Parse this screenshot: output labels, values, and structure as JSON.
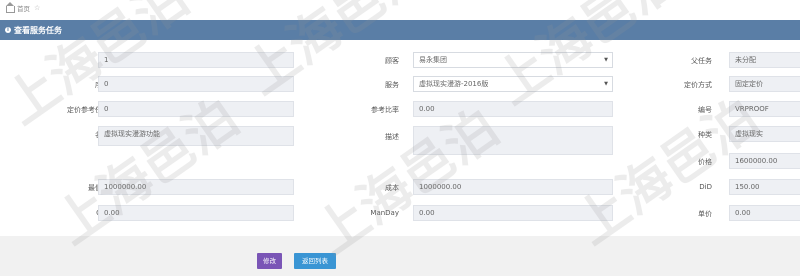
{
  "breadcrumb": {
    "home": "首页"
  },
  "panel": {
    "title": "查看服务任务"
  },
  "fields": {
    "id": {
      "label": "ID",
      "value": "1"
    },
    "client": {
      "label": "顾客",
      "value": "易永集团"
    },
    "parent_task": {
      "label": "父任务",
      "value": "未分配"
    },
    "seq": {
      "label": "序号",
      "value": "0"
    },
    "service": {
      "label": "服务",
      "value": "虚拟现实漫游-2016版"
    },
    "pricing_method": {
      "label": "定价方式",
      "value": "固定定价"
    },
    "pricing_ref_task": {
      "label": "定价参考任务",
      "value": "0"
    },
    "ref_ratio": {
      "label": "参考比率",
      "value": "0.00"
    },
    "code": {
      "label": "编号",
      "value": "VRPROOF"
    },
    "name": {
      "label": "名称",
      "value": "虚拟现实漫游功能"
    },
    "description": {
      "label": "描述",
      "value": ""
    },
    "category": {
      "label": "种类",
      "value": "虚拟现实"
    },
    "price": {
      "label": "价格",
      "value": "1600000.00"
    },
    "min_price": {
      "label": "最低价",
      "value": "1000000.00"
    },
    "cost": {
      "label": "成本",
      "value": "1000000.00"
    },
    "did": {
      "label": "DiD",
      "value": "150.00"
    },
    "ojh": {
      "label": "OJH",
      "value": "0.00"
    },
    "manday": {
      "label": "ManDay",
      "value": "0.00"
    },
    "unit_price": {
      "label": "单价",
      "value": "0.00"
    }
  },
  "buttons": {
    "edit": "修改",
    "back": "返回列表"
  },
  "watermark": "上海邑泊"
}
